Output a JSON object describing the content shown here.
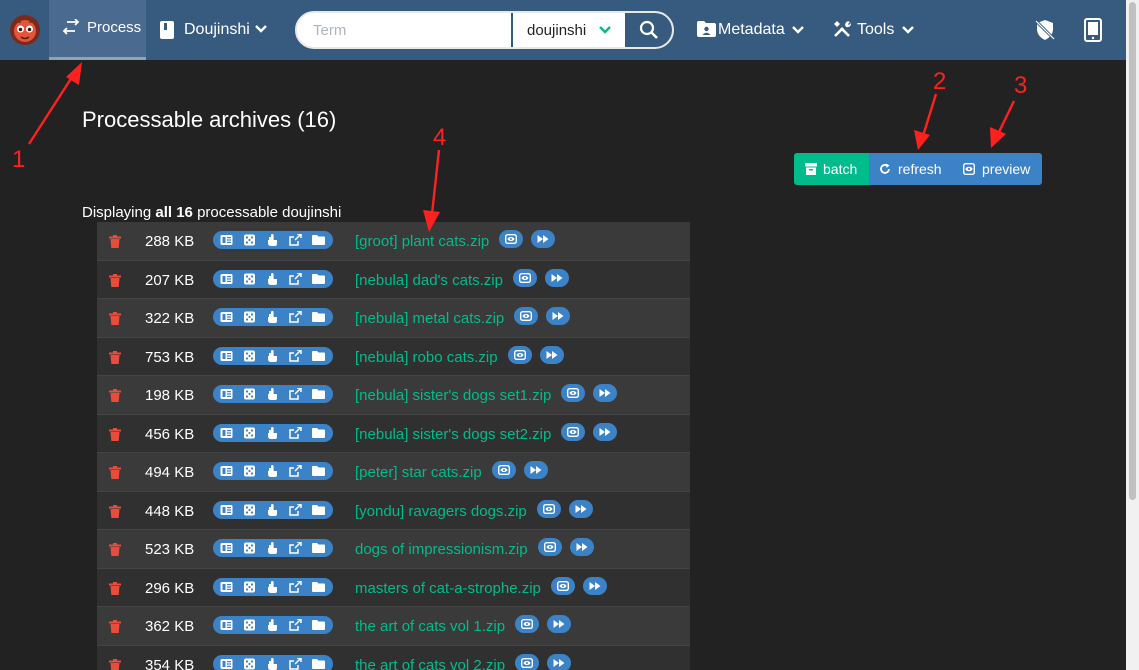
{
  "navbar": {
    "process_label": "Process",
    "doujinshi_label": "Doujinshi",
    "search_placeholder": "Term",
    "search_value": "",
    "search_category": "doujinshi",
    "metadata_label": "Metadata",
    "tools_label": "Tools"
  },
  "page": {
    "title": "Processable archives (16)",
    "display_prefix": "Displaying ",
    "display_bold": "all 16",
    "display_suffix": " processable doujinshi"
  },
  "actions": {
    "batch_label": "batch",
    "refresh_label": "refresh",
    "preview_label": "preview"
  },
  "rows": [
    {
      "size": "288 KB",
      "name": "[groot] plant cats.zip"
    },
    {
      "size": "207 KB",
      "name": "[nebula] dad's cats.zip"
    },
    {
      "size": "322 KB",
      "name": "[nebula] metal cats.zip"
    },
    {
      "size": "753 KB",
      "name": "[nebula] robo cats.zip"
    },
    {
      "size": "198 KB",
      "name": "[nebula] sister's dogs set1.zip"
    },
    {
      "size": "456 KB",
      "name": "[nebula] sister's dogs set2.zip"
    },
    {
      "size": "494 KB",
      "name": "[peter] star cats.zip"
    },
    {
      "size": "448 KB",
      "name": "[yondu] ravagers dogs.zip"
    },
    {
      "size": "523 KB",
      "name": "dogs of impressionism.zip"
    },
    {
      "size": "296 KB",
      "name": "masters of cat-a-strophe.zip"
    },
    {
      "size": "362 KB",
      "name": "the art of cats vol 1.zip"
    },
    {
      "size": "354 KB",
      "name": "the art of cats vol 2.zip"
    }
  ],
  "annotations": [
    "1",
    "2",
    "3",
    "4"
  ],
  "colors": {
    "navbar": "#375a7f",
    "accent_green": "#00bc8c",
    "accent_blue": "#3c82c6",
    "delete_red": "#e74c3c",
    "annotation_red": "#ff2020"
  }
}
